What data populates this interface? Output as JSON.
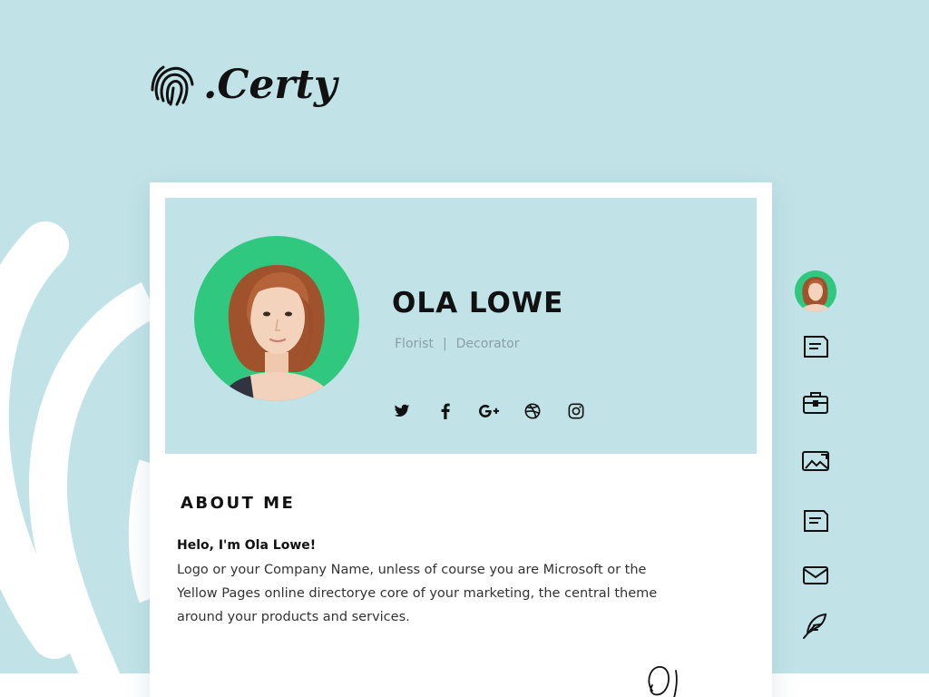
{
  "brand": {
    "logo_text": ".Certy",
    "logo_icon": "fingerprint-icon"
  },
  "profile": {
    "name": "OLA LOWE",
    "roles": [
      "Florist",
      "|",
      "Decorator"
    ],
    "accent_color": "#30c87f",
    "header_color": "#c1e3e8"
  },
  "socials": [
    {
      "name": "twitter",
      "icon": "twitter-icon",
      "glyph": "🐦"
    },
    {
      "name": "facebook",
      "icon": "facebook-icon",
      "glyph": "f"
    },
    {
      "name": "google-plus",
      "icon": "google-plus-icon",
      "glyph": "G+"
    },
    {
      "name": "dribbble",
      "icon": "dribbble-icon",
      "glyph": "◎"
    },
    {
      "name": "instagram",
      "icon": "instagram-icon",
      "glyph": "▢"
    }
  ],
  "about": {
    "title": "ABOUT ME",
    "greeting": "Helo, I'm  Ola Lowe!",
    "body": "Logo or your Company Name, unless of course you are Microsoft or the Yellow Pages online directorye core of your marketing, the central theme around your products and services."
  },
  "side_nav": [
    {
      "name": "nav-profile",
      "icon": "avatar"
    },
    {
      "name": "nav-resume",
      "icon": "document-icon"
    },
    {
      "name": "nav-portfolio",
      "icon": "briefcase-icon"
    },
    {
      "name": "nav-gallery",
      "icon": "image-icon"
    },
    {
      "name": "nav-blog",
      "icon": "document-icon"
    },
    {
      "name": "nav-contact",
      "icon": "mail-icon"
    },
    {
      "name": "nav-write",
      "icon": "feather-icon"
    }
  ]
}
